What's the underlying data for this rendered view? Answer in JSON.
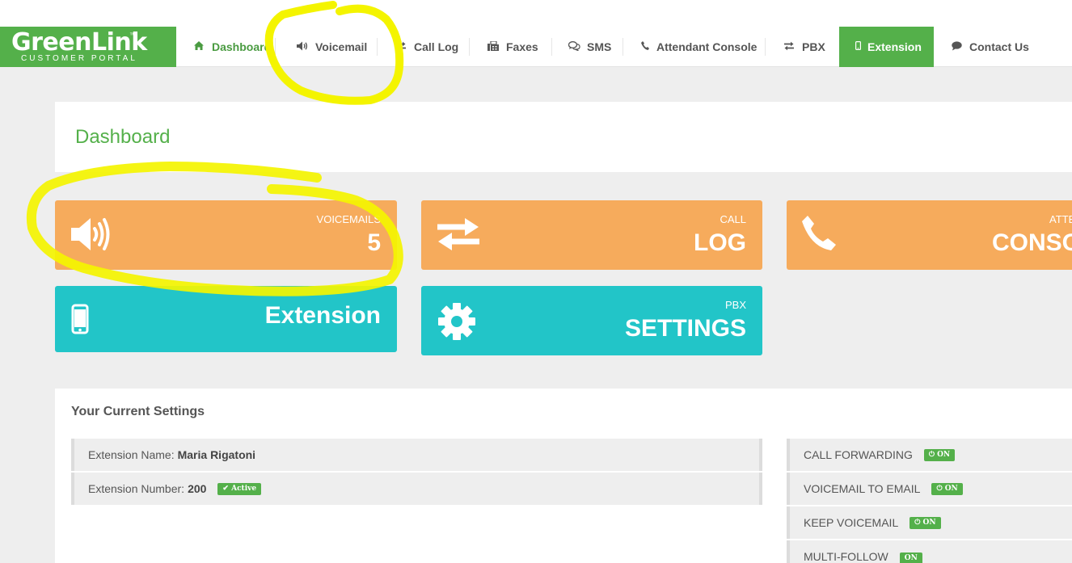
{
  "logo": {
    "name": "GreenLink",
    "trademark": "™",
    "subtitle": "CUSTOMER PORTAL"
  },
  "nav": {
    "dashboard": "Dashboard",
    "voicemail": "Voicemail",
    "call_log": "Call Log",
    "faxes": "Faxes",
    "sms": "SMS",
    "attendant_console": "Attendant Console",
    "pbx": "PBX",
    "extension": "Extension",
    "contact_us": "Contact Us"
  },
  "page_title": "Dashboard",
  "tiles": {
    "voicemails": {
      "small": "VOICEMAILS",
      "big": "5"
    },
    "call_log": {
      "small": "CALL",
      "big": "LOG"
    },
    "attendant": {
      "small": "ATTE",
      "big": "CONSO"
    },
    "extension": {
      "big": "Extension"
    },
    "pbx": {
      "small": "PBX",
      "big": "SETTINGS"
    }
  },
  "settings": {
    "title": "Your Current Settings",
    "extension_name_label": "Extension Name:",
    "extension_name_value": "Maria Rigatoni",
    "extension_number_label": "Extension Number:",
    "extension_number_value": "200",
    "active_badge": "✔ Active",
    "toggles": [
      {
        "label": "CALL FORWARDING",
        "state": "⏻ ON"
      },
      {
        "label": "VOICEMAIL TO EMAIL",
        "state": "⏻ ON"
      },
      {
        "label": "KEEP VOICEMAIL",
        "state": "⏻ ON"
      },
      {
        "label": "MULTI-FOLLOW",
        "state": "ON"
      }
    ]
  },
  "colors": {
    "brand_green": "#54b04a",
    "tile_orange": "#f6ab5c",
    "tile_teal": "#22c5c8",
    "highlighter": "#f4f400"
  }
}
